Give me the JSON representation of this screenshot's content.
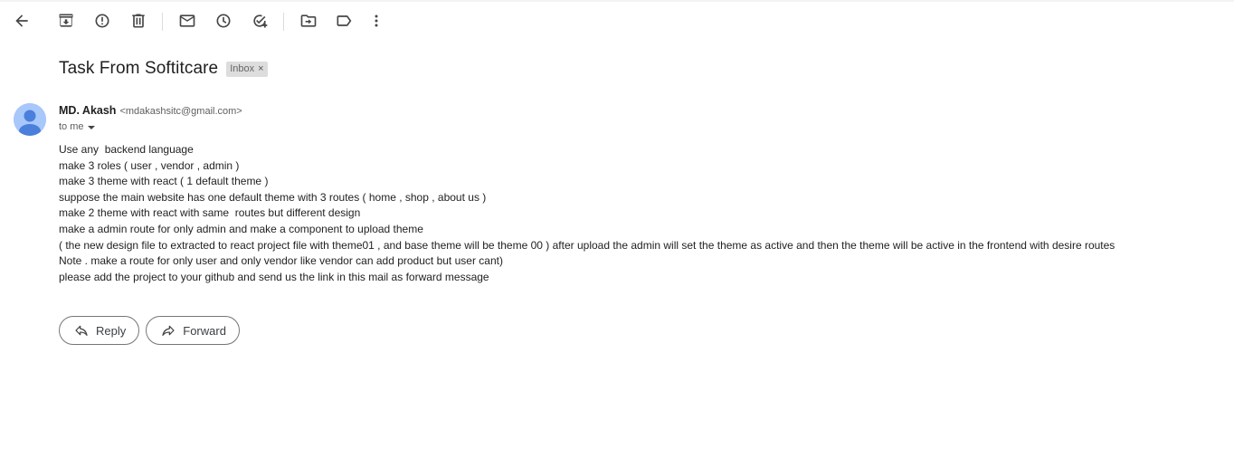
{
  "toolbar": {
    "items": [
      {
        "name": "back-button",
        "icon": "arrow-back-icon"
      },
      {
        "name": "archive-button",
        "icon": "archive-icon"
      },
      {
        "name": "report-spam-button",
        "icon": "report-spam-icon"
      },
      {
        "name": "delete-button",
        "icon": "trash-icon"
      },
      {
        "name": "mark-unread-button",
        "icon": "mail-icon"
      },
      {
        "name": "snooze-button",
        "icon": "clock-icon"
      },
      {
        "name": "add-to-tasks-button",
        "icon": "add-task-icon"
      },
      {
        "name": "move-to-button",
        "icon": "move-folder-icon"
      },
      {
        "name": "labels-button",
        "icon": "label-icon"
      },
      {
        "name": "more-button",
        "icon": "more-vert-icon"
      }
    ]
  },
  "email": {
    "subject": "Task From Softitcare",
    "label": "Inbox",
    "label_remove": "×",
    "sender_name": "MD. Akash",
    "sender_email": "<mdakashsitc@gmail.com>",
    "recipient": "to me",
    "body_lines": [
      "Use any  backend language",
      "make 3 roles ( user , vendor , admin )",
      "make 3 theme with react ( 1 default theme )",
      "suppose the main website has one default theme with 3 routes ( home , shop , about us )",
      "make 2 theme with react with same  routes but different design",
      "make a admin route for only admin and make a component to upload theme",
      "( the new design file to extracted to react project file with theme01 , and base theme will be theme 00 ) after upload the admin will set the theme as active and then the theme will be active in the frontend with desire routes",
      "Note . make a route for only user and only vendor like vendor can add product but user cant)",
      "please add the project to your github and send us the link in this mail as forward message"
    ]
  },
  "actions": {
    "reply_label": "Reply",
    "forward_label": "Forward"
  },
  "colors": {
    "icon": "#444746",
    "avatar_bg": "#a8c7fa",
    "avatar_fg": "#4a7fdb",
    "chip_bg": "#dddddd"
  }
}
